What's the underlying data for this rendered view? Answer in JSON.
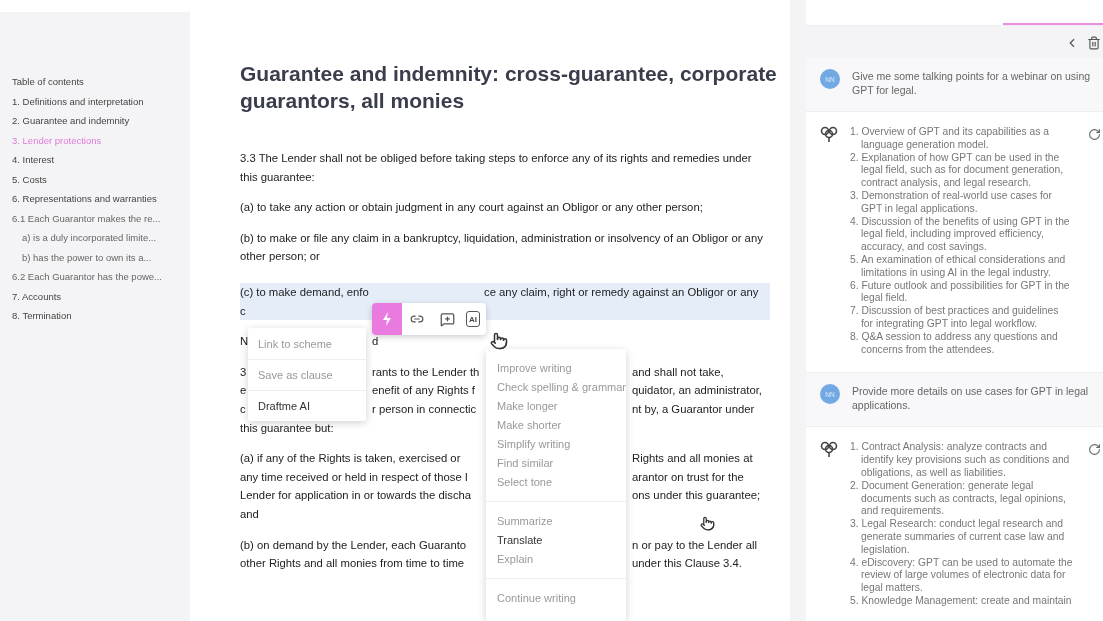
{
  "sidebar": {
    "title": "Table of contents",
    "items": [
      {
        "label": "1. Definitions and interpretation",
        "selected": false
      },
      {
        "label": "2. Guarantee and indemnity",
        "selected": false
      },
      {
        "label": "3. Lender protections",
        "selected": true
      },
      {
        "label": "4. Interest",
        "selected": false
      },
      {
        "label": "5. Costs",
        "selected": false
      },
      {
        "label": "6. Representations and warranties",
        "selected": false,
        "children": [
          {
            "label": "6.1 Each Guarantor makes the re...",
            "selected": false,
            "children": [
              {
                "label": "a) is a duly incorporated limite...",
                "selected": false
              },
              {
                "label": "b) has the power to own its a...",
                "selected": false
              }
            ]
          },
          {
            "label": "6.2 Each Guarantor has the powe...",
            "selected": false
          }
        ]
      },
      {
        "label": "7. Accounts",
        "selected": false
      },
      {
        "label": "8. Termination",
        "selected": false
      }
    ]
  },
  "document": {
    "title": "Guarantee and indemnity: cross-guarantee, corporate guarantors, all monies",
    "paragraphs": [
      {
        "highlighted": false,
        "text": "3.3  The Lender shall not be obliged before taking steps to enforce any of its rights and remedies under this guarantee:"
      },
      {
        "highlighted": false,
        "text": "(a)  to take any action or obtain judgment in any court against an Obligor or any other person;"
      },
      {
        "highlighted": false,
        "text": "(b)  to make or file any claim in a bankruptcy, liquidation, administration or insolvency of an Obligor or any other person; or"
      },
      {
        "highlighted": true,
        "lines": [
          {
            "segments": [
              {
                "kind": "start",
                "text": "(c)  to make demand, enfo"
              },
              {
                "kind": "after",
                "text": "ce any claim, right or remedy against an Obligor or any"
              }
            ]
          },
          {
            "segments": [
              {
                "kind": "start",
                "text": "c"
              }
            ]
          }
        ]
      },
      {
        "highlighted": false,
        "lines": [
          {
            "segments": [
              {
                "kind": "start",
                "text": "N"
              },
              {
                "kind": "mid",
                "text": "d"
              }
            ]
          }
        ]
      },
      {
        "highlighted": false,
        "lines": [
          {
            "segments": [
              {
                "kind": "start",
                "text": "3"
              },
              {
                "kind": "mid",
                "text": "rants to the Lender th"
              },
              {
                "kind": "right",
                "text": "and shall not take,"
              }
            ]
          },
          {
            "segments": [
              {
                "kind": "start",
                "text": "e"
              },
              {
                "kind": "mid",
                "text": "enefit of any Rights f"
              },
              {
                "kind": "right",
                "text": "quidator, an administrator,"
              }
            ]
          },
          {
            "segments": [
              {
                "kind": "start",
                "text": "c"
              },
              {
                "kind": "mid",
                "text": "r person in connectic"
              },
              {
                "kind": "right",
                "text": "nt by, a Guarantor under"
              }
            ]
          },
          {
            "segments": [
              {
                "kind": "wide",
                "text": "this guarantee but:"
              }
            ]
          }
        ]
      },
      {
        "highlighted": false,
        "lines": [
          {
            "segments": [
              {
                "kind": "wide",
                "text": "(a)  if any of the Rights is taken, exercised or"
              },
              {
                "kind": "right",
                "text": "Rights and all monies at"
              }
            ]
          },
          {
            "segments": [
              {
                "kind": "wide",
                "text": "any time received or held in respect of those I"
              },
              {
                "kind": "right",
                "text": "arantor on trust for the"
              }
            ]
          },
          {
            "segments": [
              {
                "kind": "wide",
                "text": "Lender for application in or towards the discha"
              },
              {
                "kind": "right",
                "text": "ons under this guarantee;"
              }
            ]
          },
          {
            "segments": [
              {
                "kind": "wide",
                "text": "and"
              }
            ]
          }
        ]
      },
      {
        "highlighted": false,
        "lines": [
          {
            "segments": [
              {
                "kind": "wide",
                "text": "(b)  on demand by the Lender, each Guaranto"
              },
              {
                "kind": "right",
                "text": "n or pay to the Lender all"
              }
            ]
          },
          {
            "segments": [
              {
                "kind": "wide",
                "text": "other Rights and all monies from time to time"
              },
              {
                "kind": "right",
                "text": "under this Clause 3.4."
              }
            ]
          }
        ]
      }
    ]
  },
  "toolbar": {
    "buttons": [
      {
        "kind": "lightning",
        "selected": true
      },
      {
        "kind": "link",
        "selected": false
      },
      {
        "kind": "comment",
        "selected": false
      },
      {
        "kind": "ai",
        "label": "AI",
        "selected": false
      }
    ]
  },
  "context_menu": {
    "items": [
      {
        "label": "Link to scheme",
        "disabled": true
      },
      {
        "label": "Save as clause",
        "disabled": true
      },
      {
        "label": "Draftme AI",
        "disabled": false
      }
    ]
  },
  "ai_menu": {
    "groups": [
      [
        {
          "label": "Improve writing",
          "disabled": true
        },
        {
          "label": "Check spelling & grammar",
          "disabled": true
        },
        {
          "label": "Make longer",
          "disabled": true
        },
        {
          "label": "Make shorter",
          "disabled": true
        },
        {
          "label": "Simplify writing",
          "disabled": true
        },
        {
          "label": "Find similar",
          "disabled": true
        },
        {
          "label": "Select tone",
          "disabled": true
        }
      ],
      [
        {
          "label": "Summarize",
          "disabled": true
        },
        {
          "label": "Translate",
          "disabled": false
        },
        {
          "label": "Explain",
          "disabled": true
        }
      ],
      [
        {
          "label": "Continue writing",
          "disabled": true
        }
      ]
    ]
  },
  "chat": {
    "messages": [
      {
        "kind": "user",
        "avatar": "NN",
        "text": "Give me some talking points for a webinar on using GPT for legal."
      },
      {
        "kind": "assistant",
        "items": [
          "1. Overview of GPT and its capabilities as a language generation model.",
          "2. Explanation of how GPT can be used in the legal field, such as for document generation, contract analysis, and legal research.",
          "3. Demonstration of real-world use cases for GPT in legal applications.",
          "4. Discussion of the benefits of using GPT in the legal field, including improved efficiency, accuracy, and cost savings.",
          "5. An examination of ethical considerations and limitations in using AI in the legal industry.",
          "6. Future outlook and possibilities for GPT in the legal field.",
          "7. Discussion of best practices and guidelines for integrating GPT into legal workflow.",
          "8. Q&A session to address any questions and concerns from the attendees."
        ]
      },
      {
        "kind": "user",
        "avatar": "NN",
        "text": "Provide more details on use cases for GPT in legal applications."
      },
      {
        "kind": "assistant",
        "items": [
          "1. Contract Analysis: analyze contracts and identify key provisions such as conditions and obligations, as well as liabilities.",
          "2. Document Generation: generate legal documents such as contracts, legal opinions, and requirements.",
          "3. Legal Research: conduct legal research and generate summaries of current case law and legislation.",
          "4. eDiscovery: GPT can be used to automate the review of large volumes of electronic data for legal matters.",
          "5. Knowledge Management: create and maintain"
        ]
      }
    ]
  }
}
